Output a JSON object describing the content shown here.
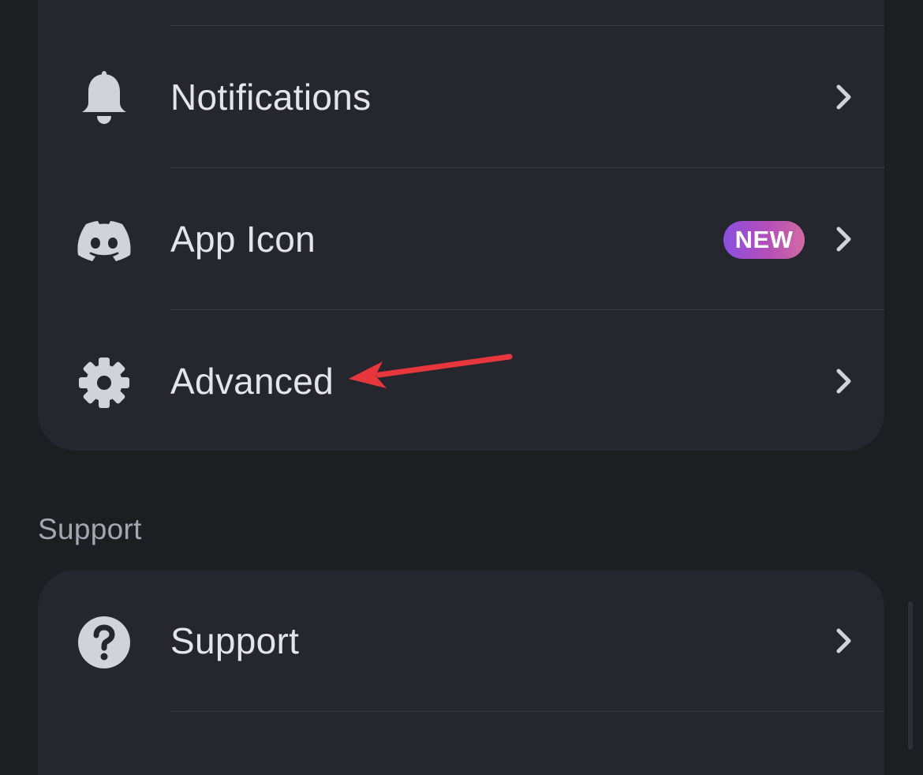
{
  "settings_card": {
    "items": [
      {
        "label": "Notifications",
        "icon": "bell-icon"
      },
      {
        "label": "App Icon",
        "icon": "discord-logo-icon",
        "badge": "NEW"
      },
      {
        "label": "Advanced",
        "icon": "gear-icon"
      }
    ]
  },
  "support_section": {
    "title": "Support",
    "items": [
      {
        "label": "Support",
        "icon": "question-circle-icon"
      }
    ]
  },
  "annotation": {
    "type": "arrow",
    "color": "#e8363d",
    "target": "Advanced"
  },
  "colors": {
    "background": "#1d1e22",
    "card": "#26272e",
    "text": "#e4e5ea",
    "icon": "#d1d3d9",
    "section_title": "#a4a6b0",
    "badge_gradient_start": "#8b4fe0",
    "badge_gradient_end": "#d36aa3"
  }
}
